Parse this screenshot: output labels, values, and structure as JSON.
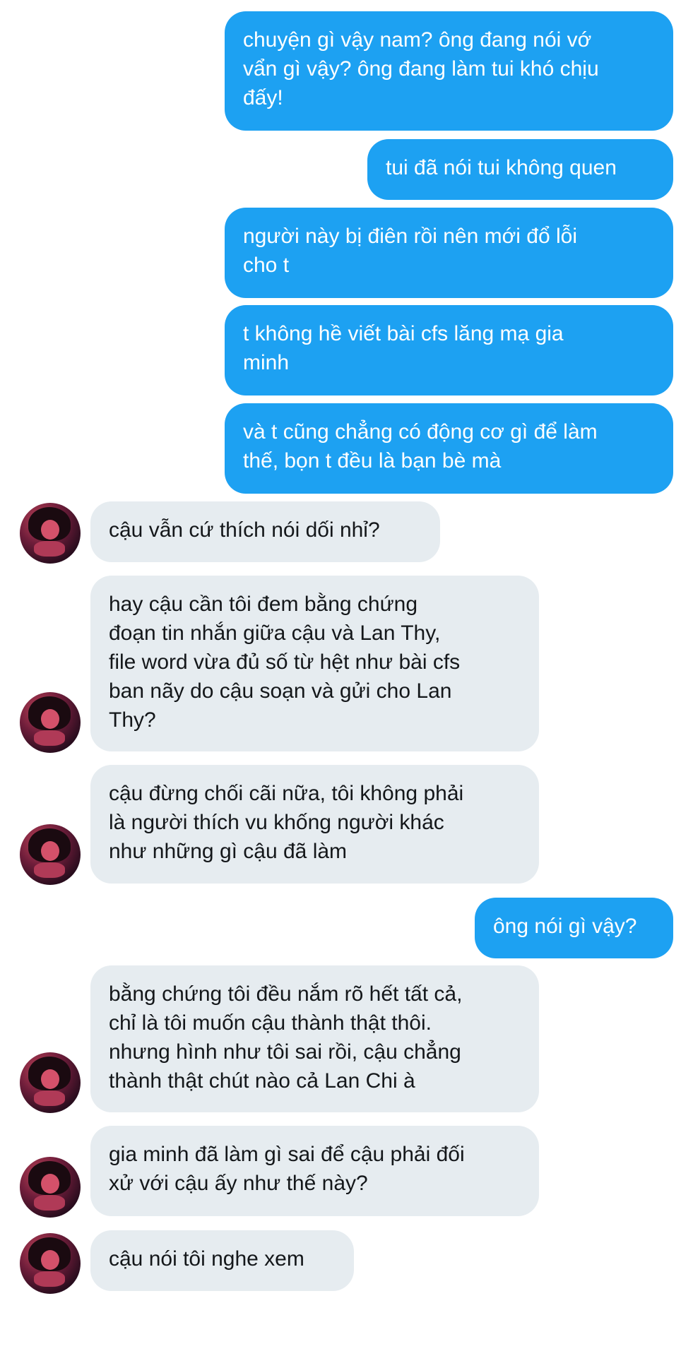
{
  "messages": [
    {
      "from": "me",
      "text": "chuyện gì vậy nam? ông đang nói vớ\nvẩn gì vậy? ông đang làm tui khó chịu\nđấy!"
    },
    {
      "from": "me",
      "text": "tui đã nói tui không quen"
    },
    {
      "from": "me",
      "text": "người này bị điên rồi nên mới đổ lỗi\ncho t"
    },
    {
      "from": "me",
      "text": "t không hề viết bài cfs lăng mạ gia\nminh"
    },
    {
      "from": "me",
      "text": "và t cũng chẳng có động cơ gì để làm\nthế, bọn t đều là bạn bè mà"
    },
    {
      "from": "them",
      "text": "cậu vẫn cứ thích nói dối nhỉ?"
    },
    {
      "from": "them",
      "text": "hay cậu cần tôi đem bằng chứng\nđoạn tin nhắn giữa cậu và Lan Thy,\nfile word vừa đủ số từ hệt như bài cfs\nban nãy do cậu soạn và gửi cho Lan\nThy?"
    },
    {
      "from": "them",
      "text": "cậu đừng chối cãi nữa, tôi không phải\nlà người thích vu khống người khác\nnhư những gì cậu đã làm"
    },
    {
      "from": "me",
      "text": "ông nói gì vậy?"
    },
    {
      "from": "them",
      "text": "bằng chứng tôi đều nắm rõ hết tất cả,\nchỉ là tôi muốn cậu thành thật thôi.\nnhưng hình như tôi sai rồi, cậu chẳng\nthành thật chút nào cả Lan Chi à"
    },
    {
      "from": "them",
      "text": "gia minh đã làm gì sai để cậu phải đối\nxử với cậu ấy như thế này?"
    },
    {
      "from": "them",
      "text": "cậu nói tôi nghe xem"
    }
  ],
  "colors": {
    "sent_bubble": "#1da1f2",
    "received_bubble": "#e6ecf0",
    "received_text": "#14171a"
  },
  "icons": {
    "avatar": "contact-avatar-photo"
  }
}
